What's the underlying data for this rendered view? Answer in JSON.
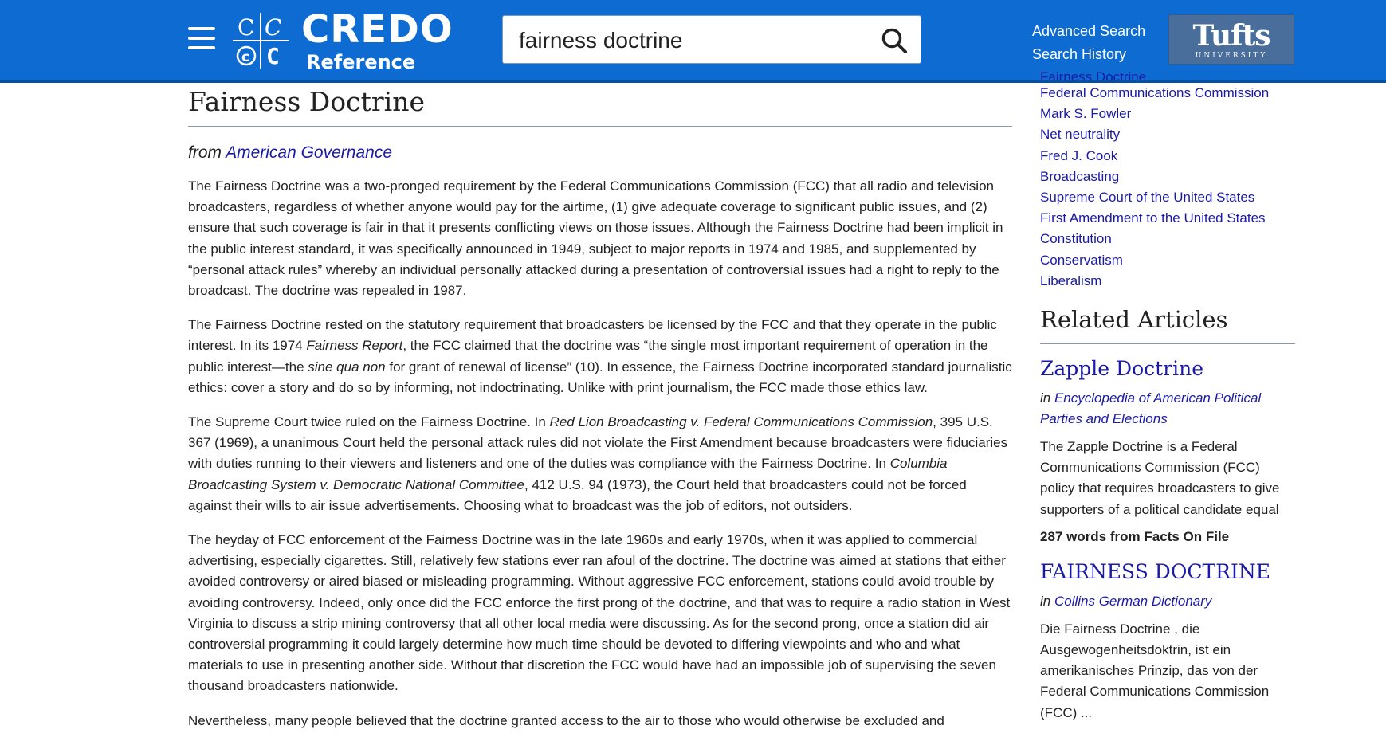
{
  "header": {
    "brand": "CREDO",
    "brand_sub": "Reference",
    "search_value": "fairness doctrine",
    "links": [
      "Advanced Search",
      "Search History"
    ],
    "institution": "Tufts",
    "institution_sub": "UNIVERSITY",
    "color": "#0d6bd1"
  },
  "article": {
    "title": "Fairness Doctrine",
    "from_label": "from",
    "source": "American Governance",
    "p1": "The Fairness Doctrine was a two-pronged requirement by the Federal Communications Commission (FCC) that all radio and television broadcasters, regardless of whether anyone would pay for the airtime, (1) give adequate coverage to significant public issues, and (2) ensure that such coverage is fair in that it presents conflicting views on those issues. Although the Fairness Doctrine had been implicit in the public interest standard, it was specifically announced in 1949, subject to major reports in 1974 and 1985, and supplemented by “personal attack rules” whereby an individual personally attacked during a presentation of controversial issues had a right to reply to the broadcast. The doctrine was repealed in 1987.",
    "p2_a": "The Fairness Doctrine rested on the statutory requirement that broadcasters be licensed by the FCC and that they operate in the public interest. In its 1974 ",
    "p2_i1": "Fairness Report",
    "p2_b": ", the FCC claimed that the doctrine was “the single most important requirement of operation in the public interest—the ",
    "p2_i2": "sine qua non",
    "p2_c": " for grant of renewal of license” (10). In essence, the Fairness Doctrine incorporated standard journalistic ethics: cover a story and do so by informing, not indoctrinating. Unlike with print journalism, the FCC made those ethics law.",
    "p3_a": "The Supreme Court twice ruled on the Fairness Doctrine. In ",
    "p3_i1": "Red Lion Broadcasting v. Federal Communications Commission",
    "p3_b": ", 395 U.S. 367 (1969), a unanimous Court held the personal attack rules did not violate the First Amendment because broadcasters were fiduciaries with duties running to their viewers and listeners and one of the duties was compliance with the Fairness Doctrine. In ",
    "p3_i2": "Columbia Broadcasting System v. Democratic National Committee",
    "p3_c": ", 412 U.S. 94 (1973), the Court held that broadcasters could not be forced against their wills to air issue advertisements. Choosing what to broadcast was the job of editors, not outsiders.",
    "p4": "The heyday of FCC enforcement of the Fairness Doctrine was in the late 1960s and early 1970s, when it was applied to commercial advertising, especially cigarettes. Still, relatively few stations ever ran afoul of the doctrine. The doctrine was aimed at stations that either avoided controversy or aired biased or misleading programming. Without aggressive FCC enforcement, stations could avoid trouble by avoiding controversy. Indeed, only once did the FCC enforce the first prong of the doctrine, and that was to require a radio station in West Virginia to discuss a strip mining controversy that all other local media were discussing. As for the second prong, once a station did air controversial programming it could largely determine how much time should be devoted to differing viewpoints and who and what materials to use in presenting another side. Without that discretion the FCC would have had an impossible job of supervising the seven thousand broadcasters nationwide.",
    "p5": "Nevertheless, many people believed that the doctrine granted access to the air to those who would otherwise be excluded and"
  },
  "sidebar": {
    "partial_top": "Fairness Doctrine",
    "keywords": [
      "Federal Communications Commission",
      "Mark S. Fowler",
      "Net neutrality",
      "Fred J. Cook",
      "Broadcasting",
      "Supreme Court of the United States",
      "First Amendment to the United States Constitution",
      "Conservatism",
      "Liberalism"
    ],
    "related_heading": "Related Articles",
    "related": [
      {
        "title": "Zapple Doctrine",
        "in_label": "in",
        "source": "Encyclopedia of American Political Parties and Elections",
        "snippet": "The Zapple Doctrine is a Federal Communications Commission (FCC) policy that requires broadcasters to give supporters of a political candidate equal",
        "words": "287 words from Facts On File"
      },
      {
        "title": "FAIRNESS DOCTRINE",
        "in_label": "in",
        "source": "Collins German Dictionary",
        "snippet": "Die Fairness Doctrine , die Ausgewogenheitsdoktrin, ist ein amerikanisches Prinzip, das von der Federal Communications Commission (FCC) ..."
      }
    ]
  },
  "colors": {
    "link": "#1a1aa6",
    "header": "#0d6bd1",
    "rule": "#8a97a8"
  },
  "icons": [
    "menu-icon",
    "credo-logo",
    "search-icon",
    "tufts-logo"
  ]
}
